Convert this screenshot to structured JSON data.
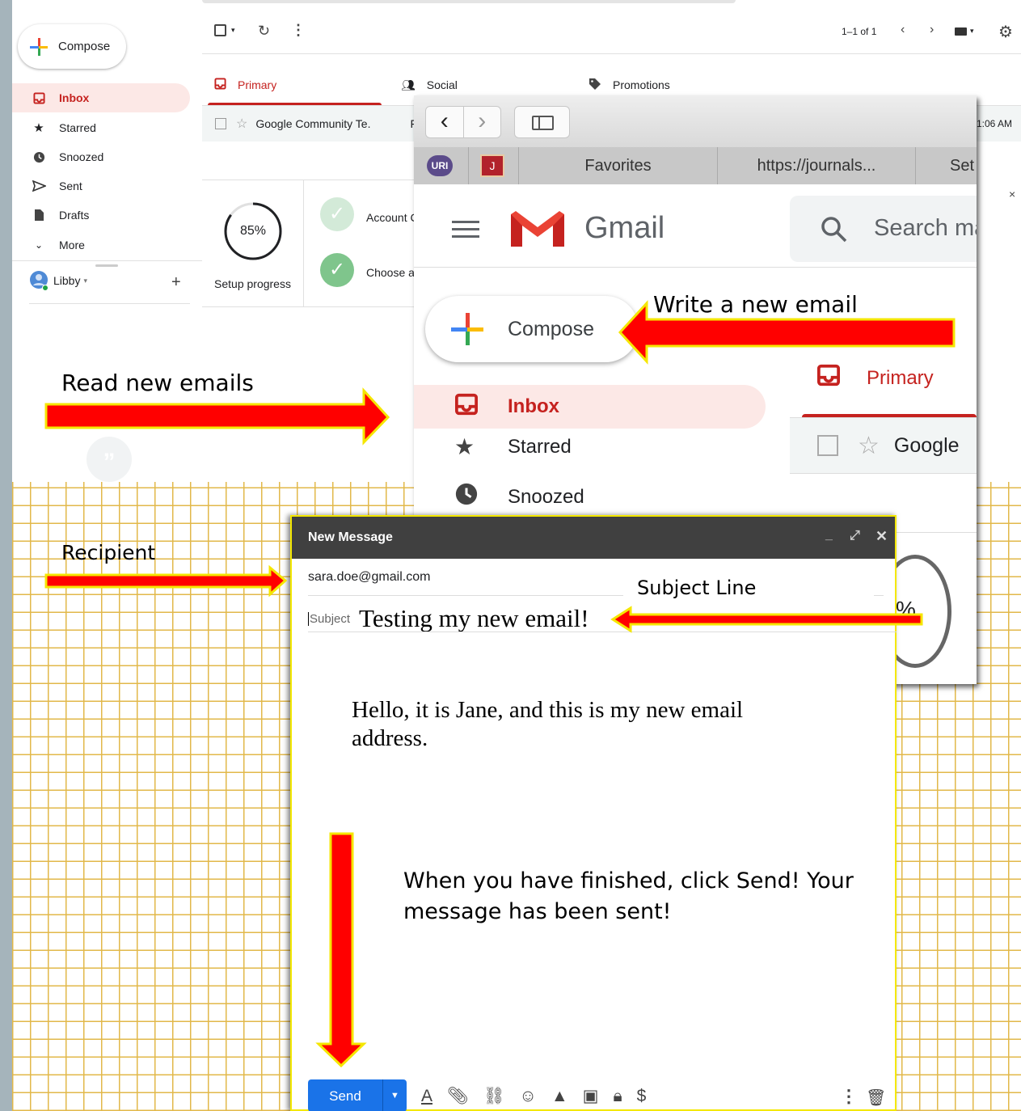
{
  "gmail_bg": {
    "compose_label": "Compose",
    "nav": [
      {
        "label": "Inbox",
        "icon": "inbox-icon"
      },
      {
        "label": "Starred",
        "icon": "star-icon"
      },
      {
        "label": "Snoozed",
        "icon": "clock-icon"
      },
      {
        "label": "Sent",
        "icon": "send-icon"
      },
      {
        "label": "Drafts",
        "icon": "draft-icon"
      },
      {
        "label": "More",
        "icon": "chevron-down-icon"
      }
    ],
    "account_name": "Libby",
    "pagination": "1–1 of 1",
    "tabs": [
      "Primary",
      "Social",
      "Promotions"
    ],
    "email_row": {
      "sender": "Google Community Te.",
      "snippet": "Fi",
      "time": "1:06 AM"
    },
    "setup": {
      "percent": "85%",
      "label": "Setup progress",
      "task1": "Account C",
      "task2": "Choose a t"
    }
  },
  "zoom_window": {
    "bookmarks": [
      "Favorites",
      "https://journals...",
      "Set"
    ],
    "app_name": "Gmail",
    "search_placeholder": "Search ma",
    "compose_label": "Compose",
    "nav": [
      "Inbox",
      "Starred",
      "Snoozed"
    ],
    "tab_primary": "Primary",
    "email_sender": "Google",
    "percent_fragment": "%"
  },
  "new_message": {
    "title": "New Message",
    "to": "sara.doe@gmail.com",
    "subject_label": "Subject",
    "subject": "Testing my new email!",
    "body": "Hello, it is Jane, and this is my new email address.",
    "send_label": "Send"
  },
  "annotations": {
    "write": "Write a new email",
    "read": "Read new emails",
    "recipient": "Recipient",
    "subject_line": "Subject Line",
    "finish": "When you have finished, click Send! Your message has been sent!"
  },
  "colors": {
    "arrow_fill": "#ff0000",
    "arrow_outline": "#f5e600",
    "gmail_red": "#c5221f",
    "send_blue": "#1a73e8"
  }
}
